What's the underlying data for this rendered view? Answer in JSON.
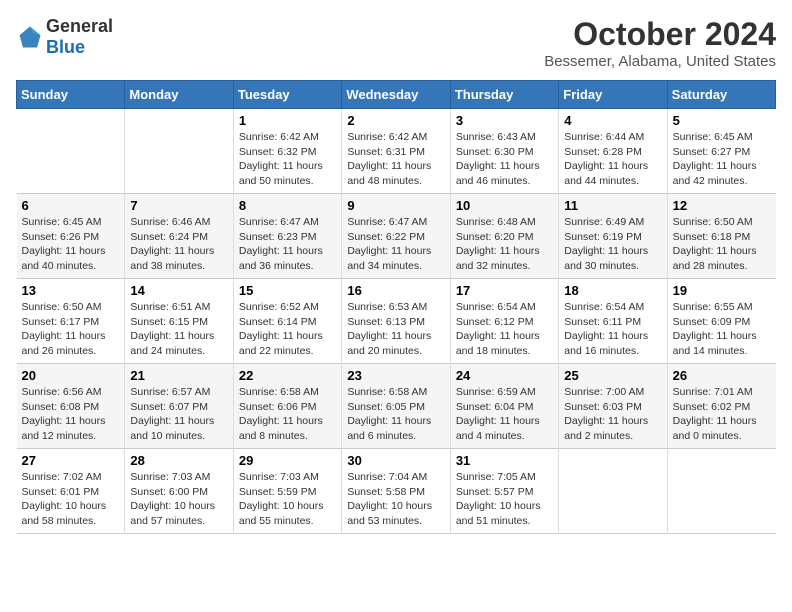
{
  "header": {
    "logo_general": "General",
    "logo_blue": "Blue",
    "month": "October 2024",
    "location": "Bessemer, Alabama, United States"
  },
  "columns": [
    "Sunday",
    "Monday",
    "Tuesday",
    "Wednesday",
    "Thursday",
    "Friday",
    "Saturday"
  ],
  "rows": [
    [
      {
        "day": "",
        "info": ""
      },
      {
        "day": "",
        "info": ""
      },
      {
        "day": "1",
        "info": "Sunrise: 6:42 AM\nSunset: 6:32 PM\nDaylight: 11 hours and 50 minutes."
      },
      {
        "day": "2",
        "info": "Sunrise: 6:42 AM\nSunset: 6:31 PM\nDaylight: 11 hours and 48 minutes."
      },
      {
        "day": "3",
        "info": "Sunrise: 6:43 AM\nSunset: 6:30 PM\nDaylight: 11 hours and 46 minutes."
      },
      {
        "day": "4",
        "info": "Sunrise: 6:44 AM\nSunset: 6:28 PM\nDaylight: 11 hours and 44 minutes."
      },
      {
        "day": "5",
        "info": "Sunrise: 6:45 AM\nSunset: 6:27 PM\nDaylight: 11 hours and 42 minutes."
      }
    ],
    [
      {
        "day": "6",
        "info": "Sunrise: 6:45 AM\nSunset: 6:26 PM\nDaylight: 11 hours and 40 minutes."
      },
      {
        "day": "7",
        "info": "Sunrise: 6:46 AM\nSunset: 6:24 PM\nDaylight: 11 hours and 38 minutes."
      },
      {
        "day": "8",
        "info": "Sunrise: 6:47 AM\nSunset: 6:23 PM\nDaylight: 11 hours and 36 minutes."
      },
      {
        "day": "9",
        "info": "Sunrise: 6:47 AM\nSunset: 6:22 PM\nDaylight: 11 hours and 34 minutes."
      },
      {
        "day": "10",
        "info": "Sunrise: 6:48 AM\nSunset: 6:20 PM\nDaylight: 11 hours and 32 minutes."
      },
      {
        "day": "11",
        "info": "Sunrise: 6:49 AM\nSunset: 6:19 PM\nDaylight: 11 hours and 30 minutes."
      },
      {
        "day": "12",
        "info": "Sunrise: 6:50 AM\nSunset: 6:18 PM\nDaylight: 11 hours and 28 minutes."
      }
    ],
    [
      {
        "day": "13",
        "info": "Sunrise: 6:50 AM\nSunset: 6:17 PM\nDaylight: 11 hours and 26 minutes."
      },
      {
        "day": "14",
        "info": "Sunrise: 6:51 AM\nSunset: 6:15 PM\nDaylight: 11 hours and 24 minutes."
      },
      {
        "day": "15",
        "info": "Sunrise: 6:52 AM\nSunset: 6:14 PM\nDaylight: 11 hours and 22 minutes."
      },
      {
        "day": "16",
        "info": "Sunrise: 6:53 AM\nSunset: 6:13 PM\nDaylight: 11 hours and 20 minutes."
      },
      {
        "day": "17",
        "info": "Sunrise: 6:54 AM\nSunset: 6:12 PM\nDaylight: 11 hours and 18 minutes."
      },
      {
        "day": "18",
        "info": "Sunrise: 6:54 AM\nSunset: 6:11 PM\nDaylight: 11 hours and 16 minutes."
      },
      {
        "day": "19",
        "info": "Sunrise: 6:55 AM\nSunset: 6:09 PM\nDaylight: 11 hours and 14 minutes."
      }
    ],
    [
      {
        "day": "20",
        "info": "Sunrise: 6:56 AM\nSunset: 6:08 PM\nDaylight: 11 hours and 12 minutes."
      },
      {
        "day": "21",
        "info": "Sunrise: 6:57 AM\nSunset: 6:07 PM\nDaylight: 11 hours and 10 minutes."
      },
      {
        "day": "22",
        "info": "Sunrise: 6:58 AM\nSunset: 6:06 PM\nDaylight: 11 hours and 8 minutes."
      },
      {
        "day": "23",
        "info": "Sunrise: 6:58 AM\nSunset: 6:05 PM\nDaylight: 11 hours and 6 minutes."
      },
      {
        "day": "24",
        "info": "Sunrise: 6:59 AM\nSunset: 6:04 PM\nDaylight: 11 hours and 4 minutes."
      },
      {
        "day": "25",
        "info": "Sunrise: 7:00 AM\nSunset: 6:03 PM\nDaylight: 11 hours and 2 minutes."
      },
      {
        "day": "26",
        "info": "Sunrise: 7:01 AM\nSunset: 6:02 PM\nDaylight: 11 hours and 0 minutes."
      }
    ],
    [
      {
        "day": "27",
        "info": "Sunrise: 7:02 AM\nSunset: 6:01 PM\nDaylight: 10 hours and 58 minutes."
      },
      {
        "day": "28",
        "info": "Sunrise: 7:03 AM\nSunset: 6:00 PM\nDaylight: 10 hours and 57 minutes."
      },
      {
        "day": "29",
        "info": "Sunrise: 7:03 AM\nSunset: 5:59 PM\nDaylight: 10 hours and 55 minutes."
      },
      {
        "day": "30",
        "info": "Sunrise: 7:04 AM\nSunset: 5:58 PM\nDaylight: 10 hours and 53 minutes."
      },
      {
        "day": "31",
        "info": "Sunrise: 7:05 AM\nSunset: 5:57 PM\nDaylight: 10 hours and 51 minutes."
      },
      {
        "day": "",
        "info": ""
      },
      {
        "day": "",
        "info": ""
      }
    ]
  ]
}
